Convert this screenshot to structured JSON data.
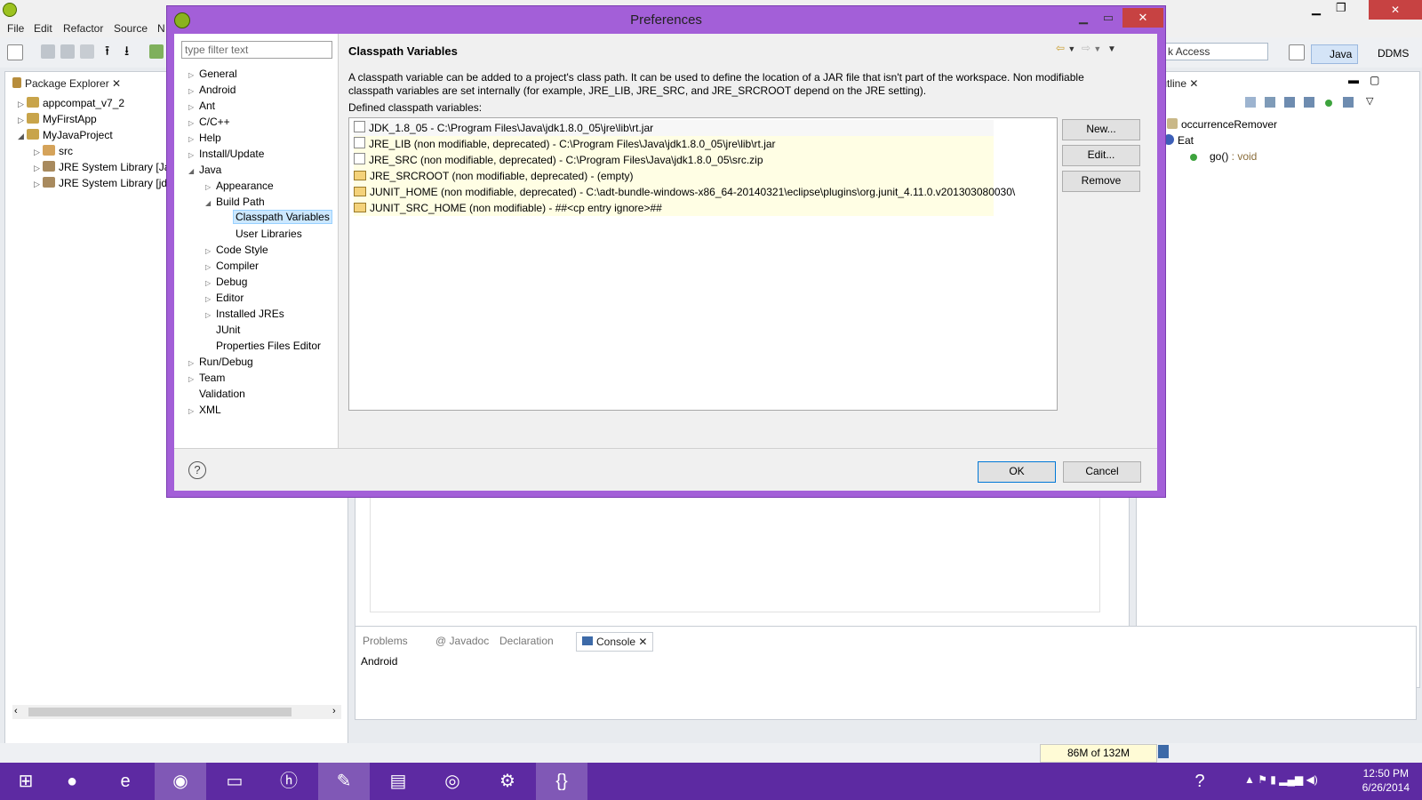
{
  "ide": {
    "menus": [
      "File",
      "Edit",
      "Refactor",
      "Source",
      "N"
    ],
    "quick_access": "k Access",
    "perspectives": [
      "Java",
      "DDMS"
    ],
    "package_explorer": {
      "tab": "Package Explorer",
      "items": [
        {
          "label": "appcompat_v7_2"
        },
        {
          "label": "MyFirstApp"
        },
        {
          "label": "MyJavaProject"
        },
        {
          "label": "src"
        },
        {
          "label": "JRE System Library [Ja"
        },
        {
          "label": "JRE System Library [jd"
        }
      ]
    },
    "outline": {
      "tab": "Outline",
      "items": [
        {
          "label": "occurrenceRemover"
        },
        {
          "label": "Eat"
        },
        {
          "label": "go()",
          "suffix": " : void"
        }
      ]
    },
    "bottom_tabs": [
      "Problems",
      "@ Javadoc",
      "Declaration",
      "Console"
    ],
    "console_text": "Android",
    "heap": "86M of 132M"
  },
  "dialog": {
    "title": "Preferences",
    "filter_placeholder": "type filter text",
    "tree": [
      {
        "label": "General"
      },
      {
        "label": "Android"
      },
      {
        "label": "Ant"
      },
      {
        "label": "C/C++"
      },
      {
        "label": "Help"
      },
      {
        "label": "Install/Update"
      },
      {
        "label": "Java"
      },
      {
        "label": "Appearance"
      },
      {
        "label": "Build Path"
      },
      {
        "label": "Classpath Variables"
      },
      {
        "label": "User Libraries"
      },
      {
        "label": "Code Style"
      },
      {
        "label": "Compiler"
      },
      {
        "label": "Debug"
      },
      {
        "label": "Editor"
      },
      {
        "label": "Installed JREs"
      },
      {
        "label": "JUnit"
      },
      {
        "label": "Properties Files Editor"
      },
      {
        "label": "Run/Debug"
      },
      {
        "label": "Team"
      },
      {
        "label": "Validation"
      },
      {
        "label": "XML"
      }
    ],
    "page_title": "Classpath Variables",
    "description": "A classpath variable can be added to a project's class path. It can be used to define the location of a JAR file that isn't part of the workspace. Non modifiable classpath variables are set internally (for example, JRE_LIB, JRE_SRC, and JRE_SRCROOT depend on the JRE setting).",
    "defined_label": "Defined classpath variables:",
    "variables": [
      "JDK_1.8_05 - C:\\Program Files\\Java\\jdk1.8.0_05\\jre\\lib\\rt.jar",
      "JRE_LIB (non modifiable, deprecated) - C:\\Program Files\\Java\\jdk1.8.0_05\\jre\\lib\\rt.jar",
      "JRE_SRC (non modifiable, deprecated) - C:\\Program Files\\Java\\jdk1.8.0_05\\src.zip",
      "JRE_SRCROOT (non modifiable, deprecated) - (empty)",
      "JUNIT_HOME (non modifiable, deprecated) - C:\\adt-bundle-windows-x86_64-20140321\\eclipse\\plugins\\org.junit_4.11.0.v201303080030\\",
      "JUNIT_SRC_HOME (non modifiable) - ##<cp entry ignore>##"
    ],
    "buttons": {
      "new": "New...",
      "edit": "Edit...",
      "remove": "Remove",
      "ok": "OK",
      "cancel": "Cancel"
    }
  },
  "taskbar": {
    "time": "12:50 PM",
    "date": "6/26/2014"
  },
  "colors": {
    "dialog_frame": "#a35fd8",
    "taskbar": "#5d2aa2",
    "close_button": "#c74242",
    "selection": "#cce8ff"
  }
}
